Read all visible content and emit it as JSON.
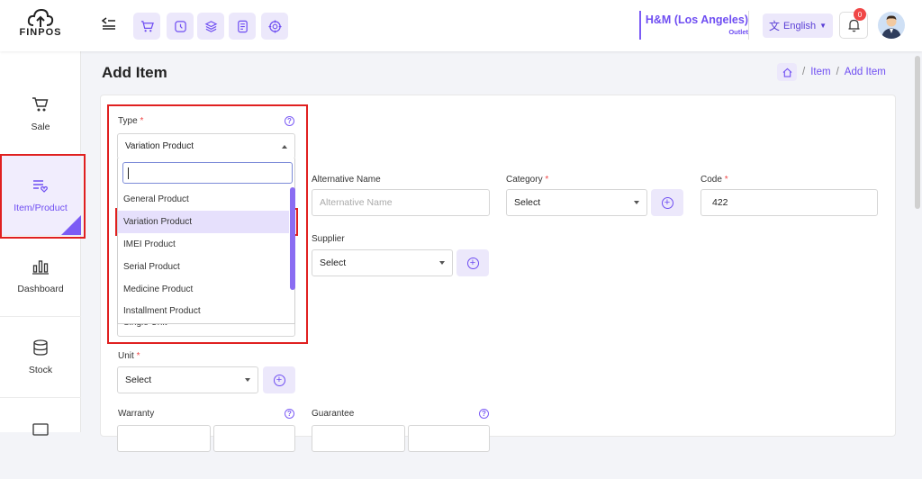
{
  "logo": {
    "text": "FINPOS"
  },
  "outlet": {
    "name": "H&M (Los Angeles)",
    "sub": "Outlet"
  },
  "language": {
    "label": "English"
  },
  "notifications": {
    "count": "0"
  },
  "sidebar": {
    "items": [
      {
        "label": "Sale"
      },
      {
        "label": "Item/Product"
      },
      {
        "label": "Dashboard"
      },
      {
        "label": "Stock"
      }
    ]
  },
  "page": {
    "title": "Add Item"
  },
  "breadcrumb": {
    "item": "Item",
    "current": "Add Item",
    "sep": "/"
  },
  "form": {
    "type": {
      "label": "Type",
      "value": "Variation Product"
    },
    "alt_name": {
      "label": "Alternative Name",
      "placeholder": "Alternative Name"
    },
    "category": {
      "label": "Category",
      "value": "Select"
    },
    "code": {
      "label": "Code",
      "value": "422"
    },
    "supplier": {
      "label": "Supplier",
      "value": "Select"
    },
    "unit_type_value": "Single Unit",
    "unit": {
      "label": "Unit",
      "value": "Select"
    },
    "warranty": {
      "label": "Warranty"
    },
    "guarantee": {
      "label": "Guarantee"
    },
    "required_mark": "*",
    "help_mark": "?"
  },
  "dropdown": {
    "options": [
      "General Product",
      "Variation Product",
      "IMEI Product",
      "Serial Product",
      "Medicine Product",
      "Installment Product"
    ],
    "selected_index": 1
  },
  "colors": {
    "accent": "#6f4ef2",
    "highlight": "#e02020"
  }
}
